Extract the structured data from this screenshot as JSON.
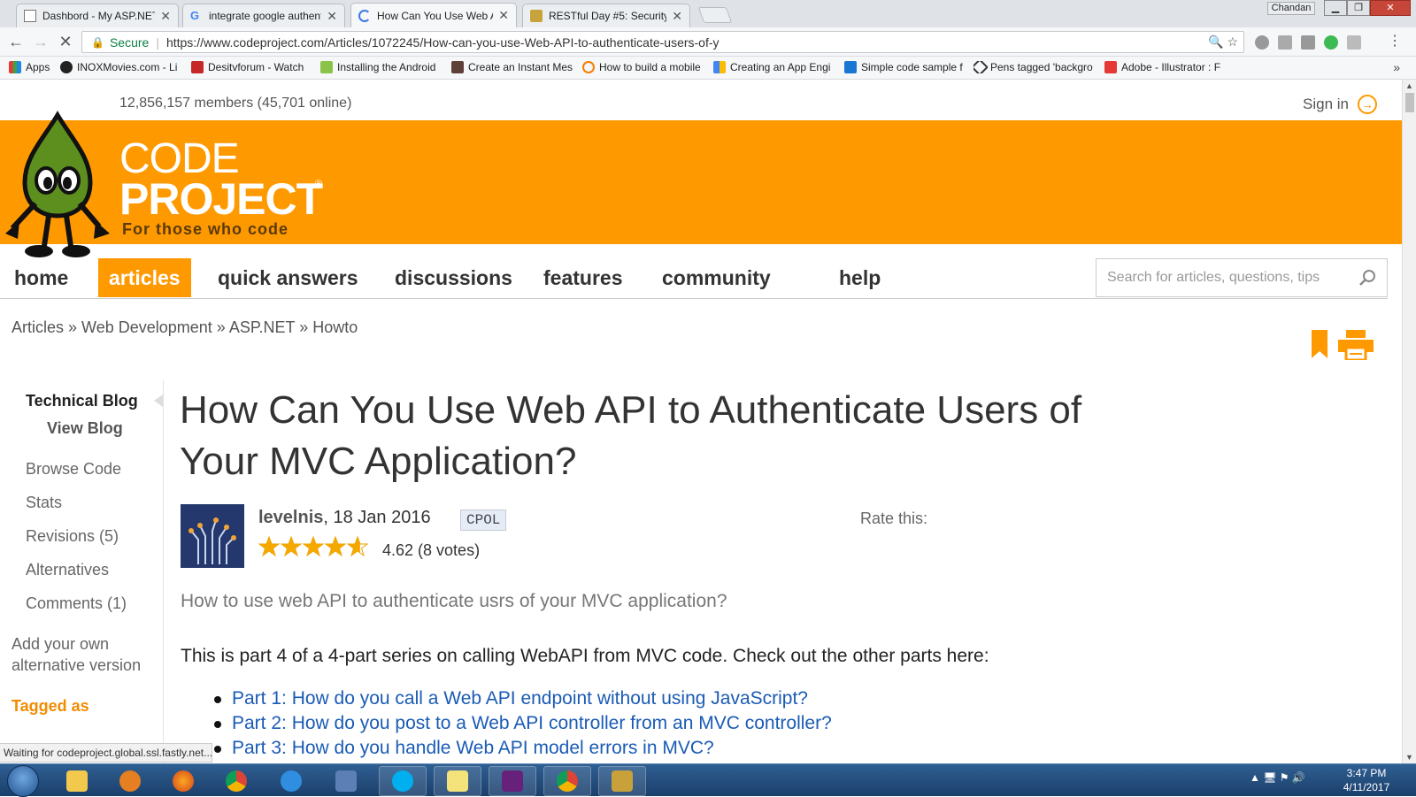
{
  "browser": {
    "tabs": [
      {
        "label": "Dashbord - My ASP.NET",
        "active": false
      },
      {
        "label": "integrate google authent",
        "active": false
      },
      {
        "label": "How Can You Use Web A",
        "active": true
      },
      {
        "label": "RESTful Day #5: Security",
        "active": false
      }
    ],
    "profile_name": "Chandan",
    "secure_label": "Secure",
    "url": "https://www.codeproject.com/Articles/1072245/How-can-you-use-Web-API-to-authenticate-users-of-y",
    "bookmarks": [
      "Apps",
      "INOXMovies.com - Li",
      "Desitvforum - Watch",
      "Installing the Android",
      "Create an Instant Mes",
      "How to build a mobile",
      "Creating an App Engi",
      "Simple code sample f",
      "Pens tagged 'backgro",
      "Adobe - Illustrator : F"
    ],
    "status_text": "Waiting for codeproject.global.ssl.fastly.net..."
  },
  "site": {
    "members": "12,856,157 members (45,701 online)",
    "sign_in": "Sign in",
    "logo_code": "CODE",
    "logo_project": "PROJECT",
    "logo_tagline": "For those who code",
    "nav": [
      "home",
      "articles",
      "quick answers",
      "discussions",
      "features",
      "community",
      "help"
    ],
    "active_nav": "articles",
    "search_placeholder": "Search for articles, questions, tips",
    "breadcrumb": [
      "Articles",
      "Web Development",
      "ASP.NET",
      "Howto"
    ],
    "breadcrumb_sep": " » "
  },
  "sidebar": {
    "type": "Technical Blog",
    "view_blog": "View Blog",
    "items": [
      "Browse Code",
      "Stats",
      "Revisions (5)",
      "Alternatives",
      "Comments (1)"
    ],
    "add_alt_line1": "Add your own",
    "add_alt_line2": "alternative version",
    "tagged": "Tagged as"
  },
  "article": {
    "title": "How Can You Use Web API to Authenticate Users of Your MVC Application?",
    "author": "levelnis",
    "date": ", 18 Jan 2016",
    "license": "CPOL",
    "rating_value": 4.62,
    "rating_text": "4.62 (8 votes)",
    "rate_this": "Rate this:",
    "summary": "How to use web API to authenticate usrs of your MVC application?",
    "intro": "This is part 4 of a 4-part series on calling WebAPI from MVC code. Check out the other parts here:",
    "parts": [
      "Part 1: How do you call a Web API endpoint without using JavaScript?",
      "Part 2: How do you post to a Web API controller from an MVC controller?",
      "Part 3: How do you handle Web API model errors in MVC?"
    ]
  },
  "taskbar": {
    "time": "3:47 PM",
    "date": "4/11/2017"
  },
  "colors": {
    "accent": "#ff9900",
    "link": "#1a5bb5"
  }
}
